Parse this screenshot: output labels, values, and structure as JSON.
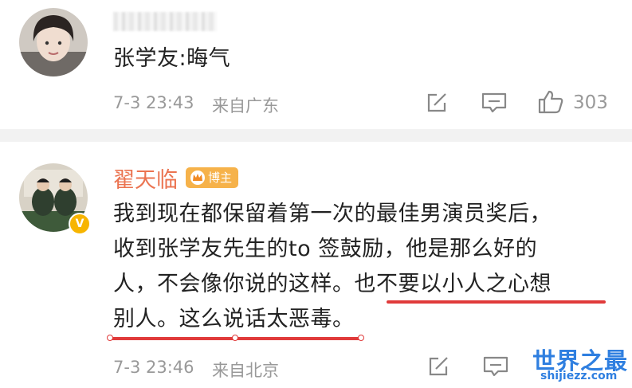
{
  "comments": [
    {
      "username": "",
      "text": "张学友:晦气",
      "time": "7-3 23:43",
      "location": "来自广东",
      "like_count": "303",
      "icons": [
        "share-icon",
        "comment-icon",
        "like-icon"
      ]
    },
    {
      "username": "翟天临",
      "role_badge": "博主",
      "verified_badge": "V",
      "text_lines": [
        "我到现在都保留着第一次的最佳男演员奖后，",
        "收到张学友先生的to 签鼓励，他是那么好的",
        "人，不会像你说的这样。也不要以小人之心想",
        "别人。这么说话太恶毒。"
      ],
      "time": "7-3 23:46",
      "location": "来自北京",
      "icons": [
        "share-icon",
        "comment-icon"
      ]
    }
  ],
  "colors": {
    "username": "#eb7350",
    "underline": "#e03a3a",
    "meta": "#999999",
    "separator": "#f2f2f2",
    "watermark": "#2f7fe0"
  },
  "watermark": {
    "title": "世界之最",
    "url": "shijiezz.com"
  }
}
